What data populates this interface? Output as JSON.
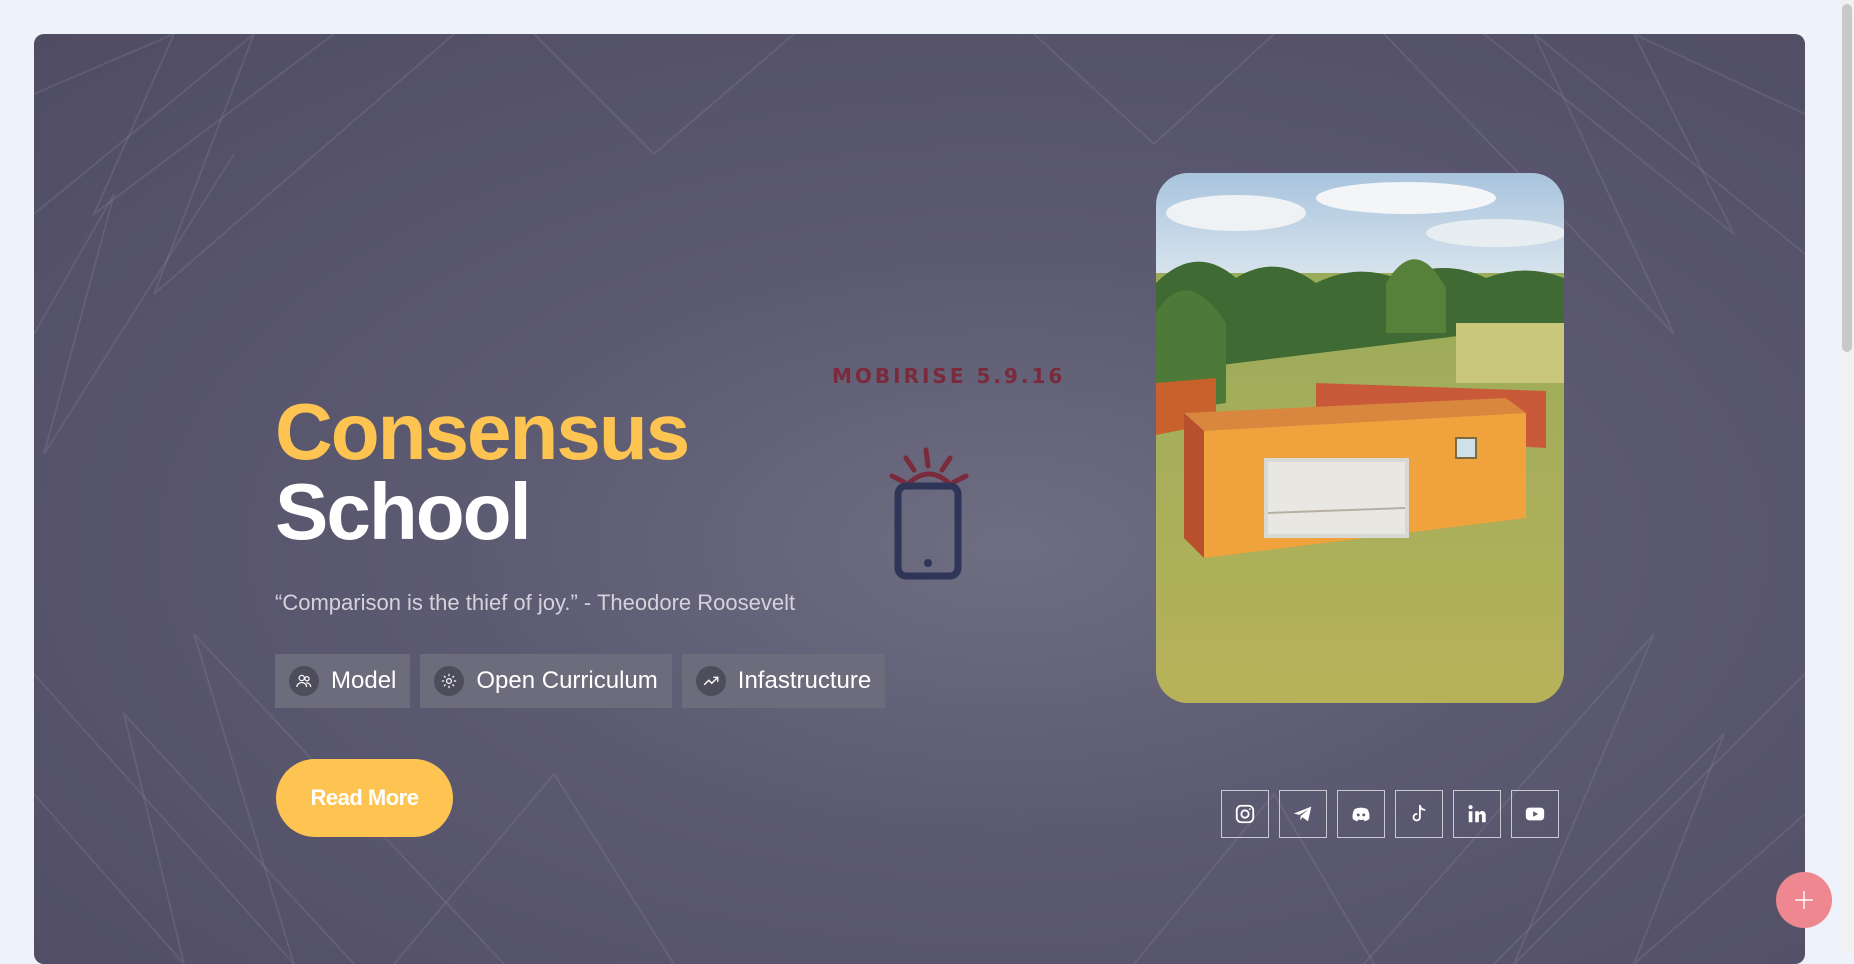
{
  "hero": {
    "title_line1": "Consensus",
    "title_line2": "School",
    "quote": "“Comparison is the thief of joy.” - Theodore Roosevelt",
    "chips": [
      {
        "label": "Model",
        "icon": "people-icon"
      },
      {
        "label": "Open Curriculum",
        "icon": "gear-icon"
      },
      {
        "label": "Infastructure",
        "icon": "trending-up-icon"
      }
    ],
    "read_more_label": "Read More",
    "badge": "MOBIRISE 5.9.16",
    "photo_alt": "Orange shipping container classrooms in a grassy field"
  },
  "socials": [
    "instagram-icon",
    "telegram-icon",
    "discord-icon",
    "tiktok-icon",
    "linkedin-icon",
    "youtube-icon"
  ],
  "fab": {
    "icon": "plus-icon"
  },
  "colors": {
    "accent": "#fec452",
    "hero_bg": "#5c5a70",
    "badge": "#7b2a3c",
    "fab": "#ee8790",
    "page_bg": "#eef2fa"
  }
}
